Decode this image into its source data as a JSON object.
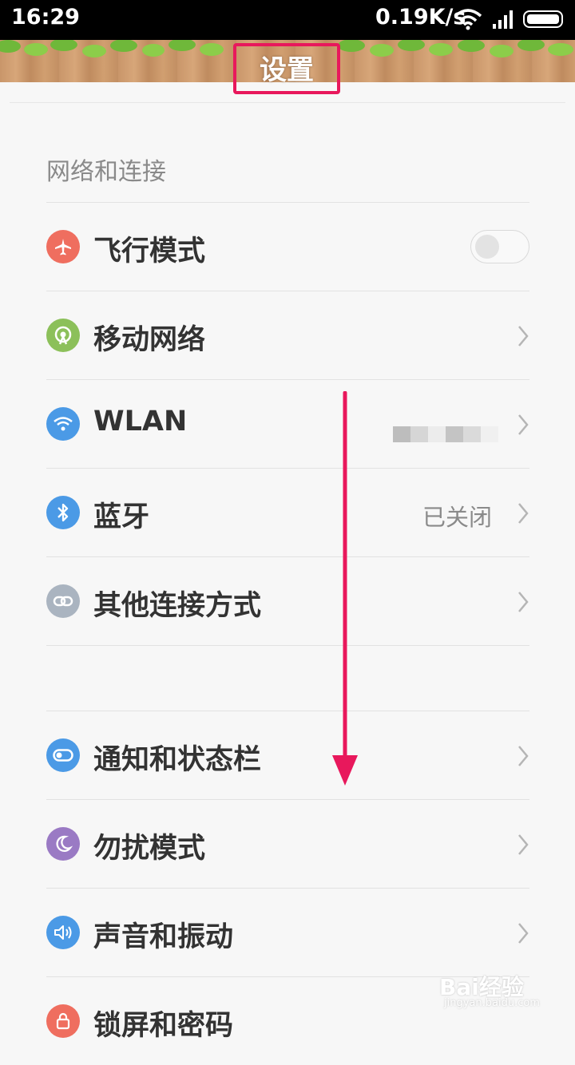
{
  "status_bar": {
    "time": "16:29",
    "net_speed": "0.19K/s"
  },
  "header": {
    "title": "设置"
  },
  "section_network": {
    "title": "网络和连接"
  },
  "rows": [
    {
      "label": "飞行模式",
      "icon": "airplane-icon",
      "icon_color": "#ef6e5f",
      "control": "toggle",
      "toggle_on": false
    },
    {
      "label": "移动网络",
      "icon": "mobile-network-icon",
      "icon_color": "#8cc05a",
      "control": "chevron"
    },
    {
      "label": "WLAN",
      "icon": "wifi-icon",
      "icon_color": "#4b9ae6",
      "control": "chevron",
      "value_obscured": true
    },
    {
      "label": "蓝牙",
      "icon": "bluetooth-icon",
      "icon_color": "#4b9ae6",
      "control": "chevron",
      "value": "已关闭"
    },
    {
      "label": "其他连接方式",
      "icon": "link-icon",
      "icon_color": "#aab4c0",
      "control": "chevron"
    },
    {
      "label": "通知和状态栏",
      "icon": "notification-toggle-icon",
      "icon_color": "#4b9ae6",
      "control": "chevron"
    },
    {
      "label": "勿扰模式",
      "icon": "moon-icon",
      "icon_color": "#9a7ac4",
      "control": "chevron"
    },
    {
      "label": "声音和振动",
      "icon": "speaker-icon",
      "icon_color": "#4b9ae6",
      "control": "chevron"
    },
    {
      "label": "锁屏和密码",
      "icon": "lock-icon",
      "icon_color": "#ef6e5f",
      "control": "chevron"
    }
  ],
  "annotations": {
    "highlight_color": "#e8185c",
    "scroll_arrow": "down"
  },
  "watermark": {
    "brand": "Bai经验",
    "url": "jingyan.baidu.com"
  }
}
